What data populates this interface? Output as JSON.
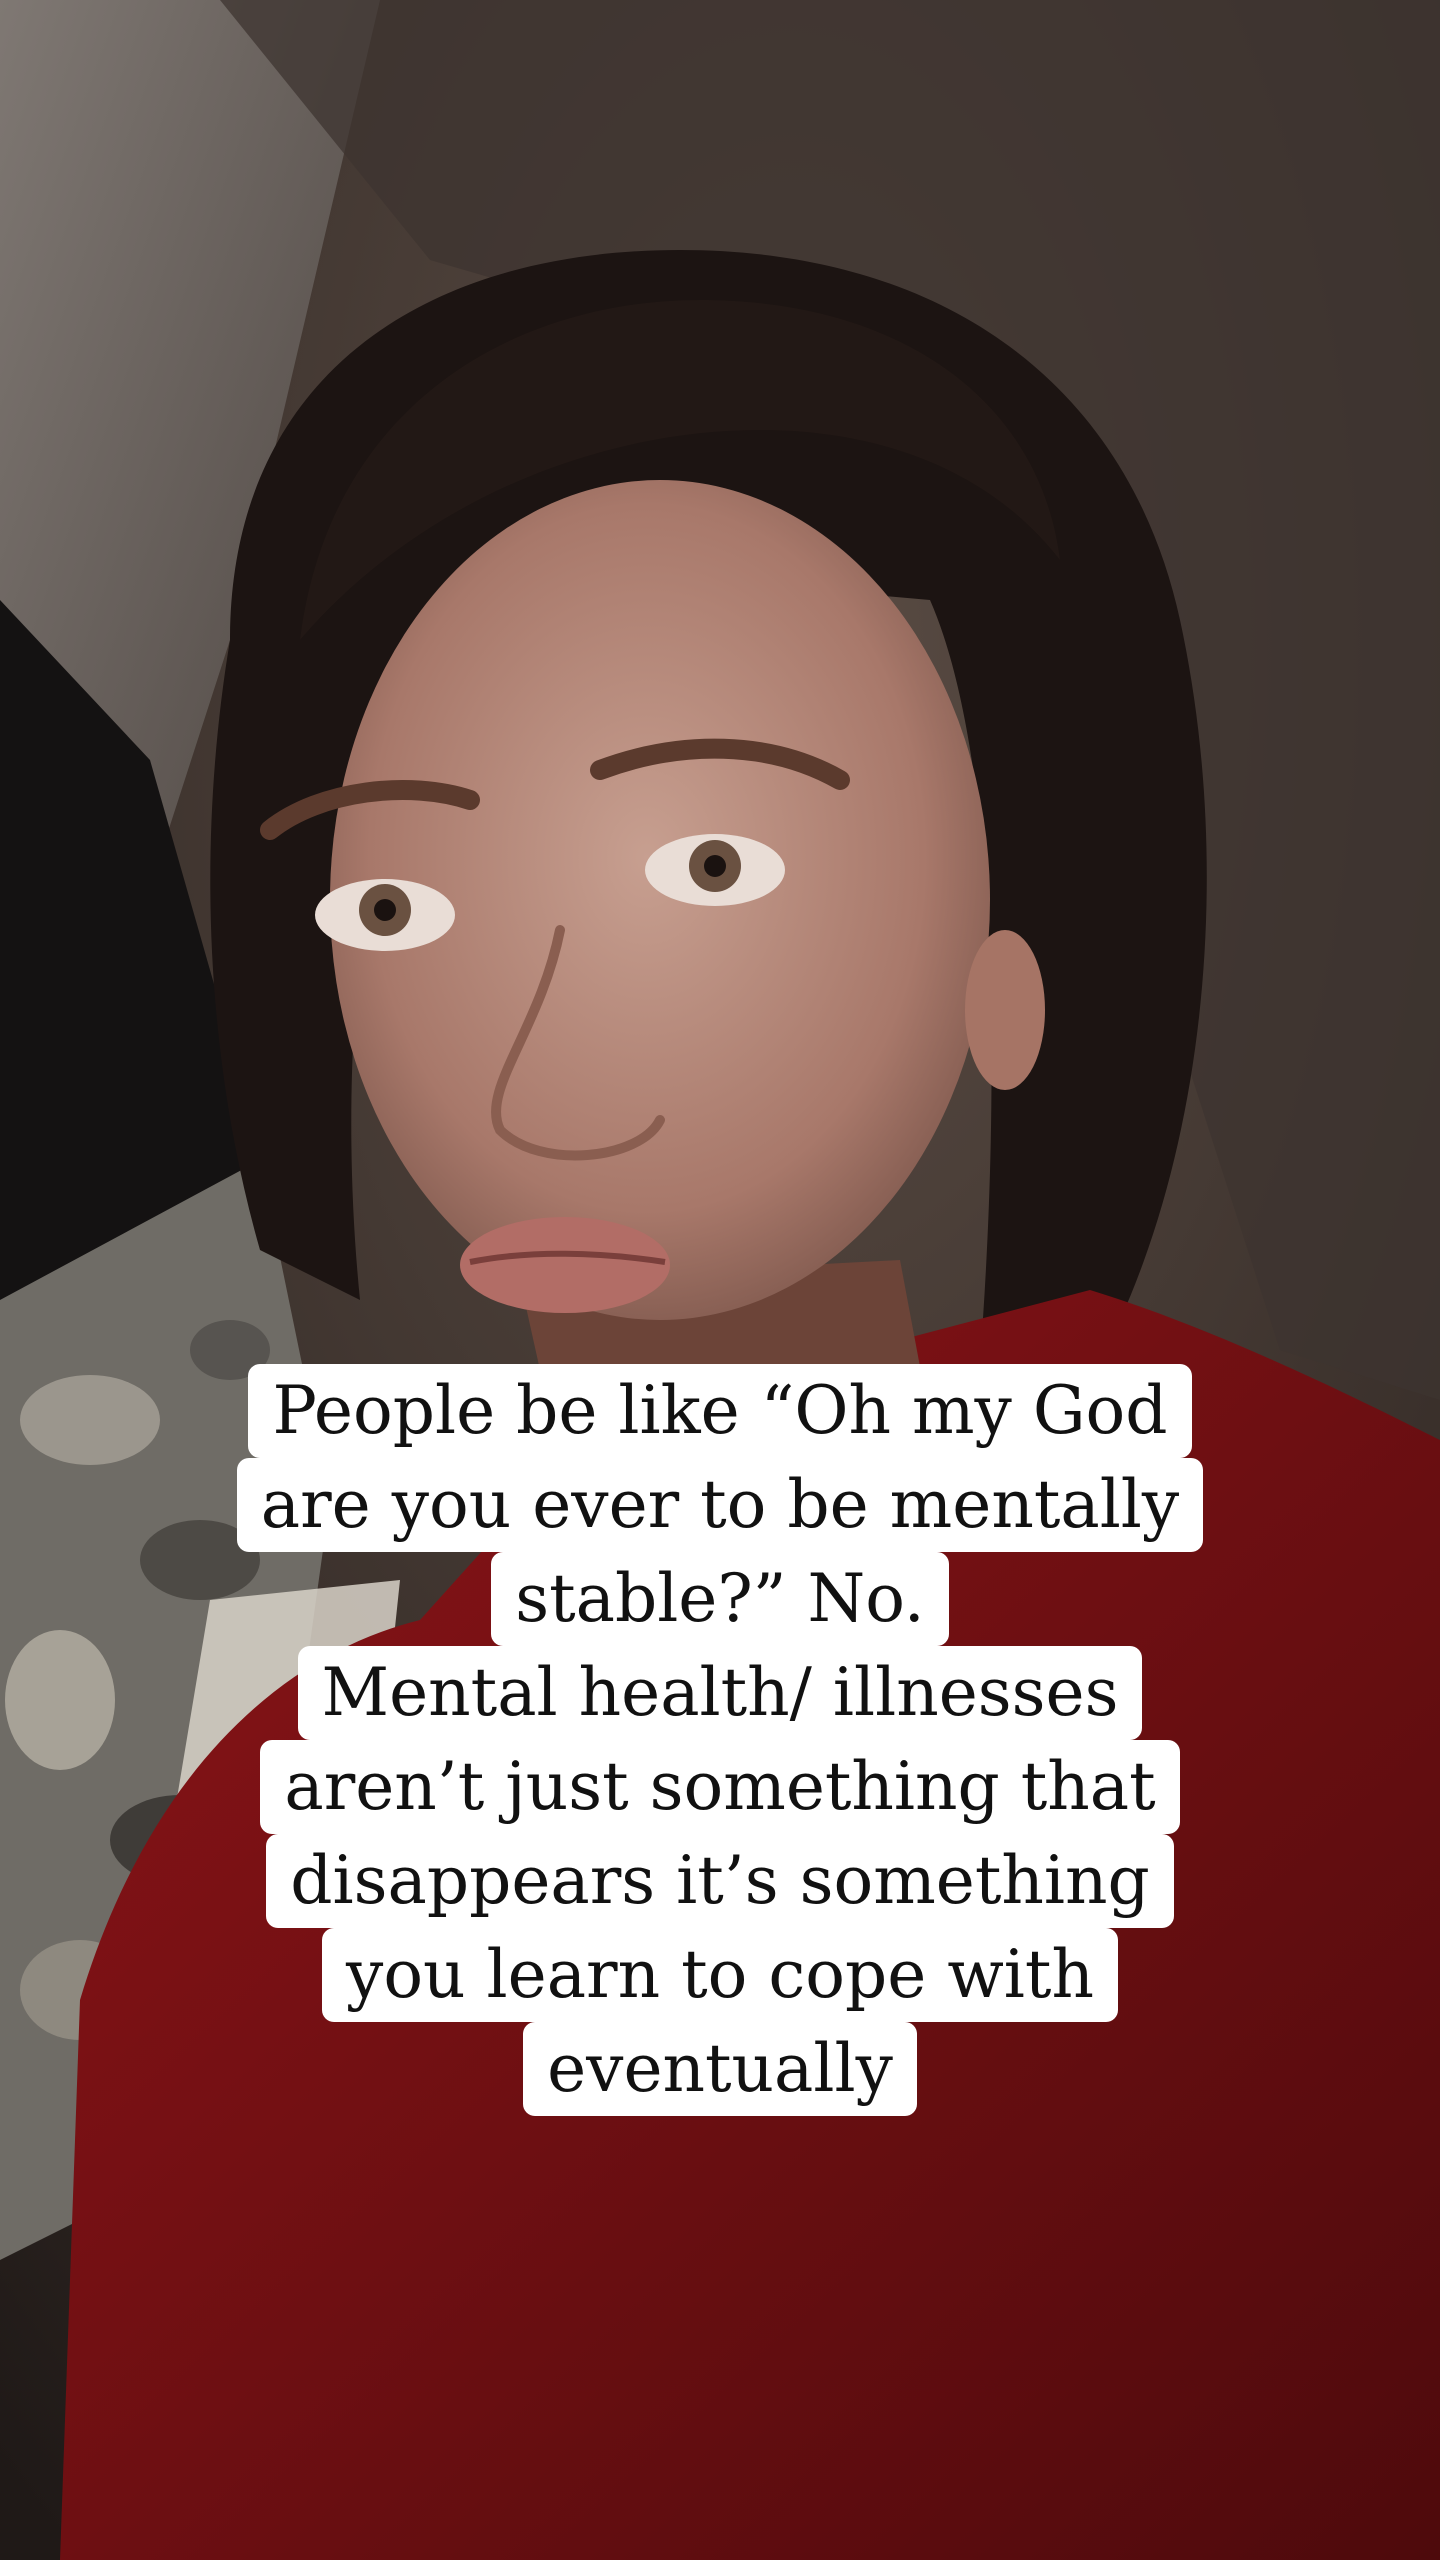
{
  "story": {
    "caption_lines": [
      "People be like “Oh my God",
      "are you ever to be mentally",
      "stable?” No.",
      "Mental health/ illnesses",
      "aren’t just something that",
      "disappears it’s something",
      "you learn to cope with",
      "eventually"
    ]
  },
  "colors": {
    "caption_background": "#ffffff",
    "caption_text": "#111111",
    "sweater": "#7a0f12",
    "hair": "#1c1412",
    "skin": "#b98f80"
  }
}
